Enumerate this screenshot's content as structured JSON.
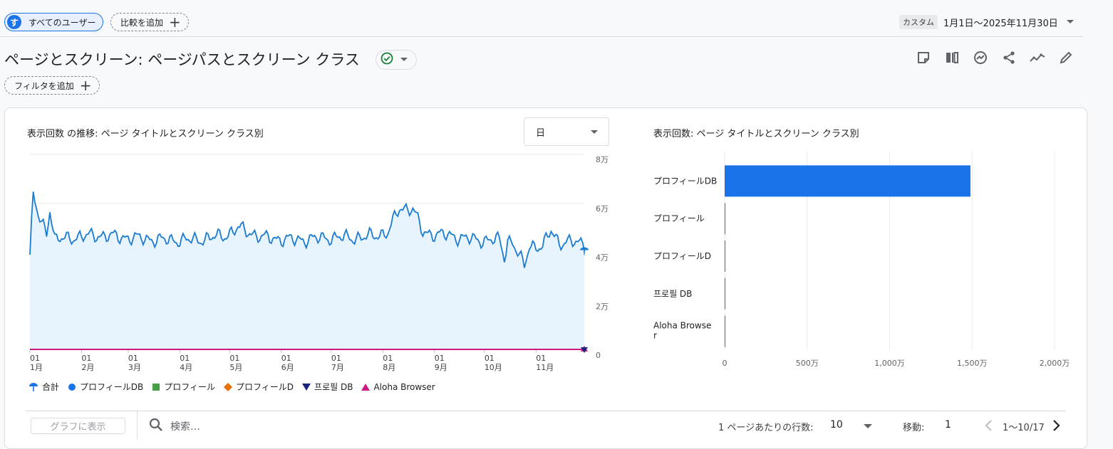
{
  "top_bar": {
    "user_avatar": "す",
    "user_label": "すべてのユーザー",
    "add_compare_label": "比較を追加",
    "date_type": "カスタム",
    "date_range": "1月1日～2025年11月30日"
  },
  "page": {
    "title": "ページとスクリーン: ページパスとスクリーン クラス",
    "add_filter_label": "フィルタを追加"
  },
  "line_chart_card": {
    "title": "表示回数 の推移: ページ タイトルとスクリーン クラス別",
    "granularity": "日"
  },
  "bar_chart_card": {
    "title": "表示回数: ページ タイトルとスクリーン クラス別"
  },
  "legend": [
    {
      "label": "合計",
      "color": "#1a73e8",
      "marker": "total"
    },
    {
      "label": "プロフィールDB",
      "color": "#1a73e8",
      "marker": "circle"
    },
    {
      "label": "プロフィール",
      "color": "#43a047",
      "marker": "square"
    },
    {
      "label": "プロフィールD",
      "color": "#e8710a",
      "marker": "diamond"
    },
    {
      "label": "프로필 DB",
      "color": "#1a237e",
      "marker": "triangle-down"
    },
    {
      "label": "Aloha Browser",
      "color": "#d01884",
      "marker": "triangle-up"
    }
  ],
  "table_controls": {
    "graph_button": "グラフに表示",
    "search_placeholder": "検索…",
    "rows_label": "1 ページあたりの行数:",
    "rows_value": "10",
    "goto_label": "移動:",
    "goto_value": "1",
    "range_label": "1～10/17"
  },
  "colors": {
    "accent": "#1a73e8",
    "area_fill": "#e8f4fd",
    "line": "#1a7bd0",
    "secondary_line": "#d01884"
  },
  "chart_data": [
    {
      "type": "line",
      "title": "表示回数 の推移: ページ タイトルとスクリーン クラス別",
      "x_ticks": [
        {
          "day": "01",
          "month": "1月",
          "index": 0
        },
        {
          "day": "01",
          "month": "2月",
          "index": 31
        },
        {
          "day": "01",
          "month": "3月",
          "index": 59
        },
        {
          "day": "01",
          "month": "4月",
          "index": 90
        },
        {
          "day": "01",
          "month": "5月",
          "index": 120
        },
        {
          "day": "01",
          "month": "6月",
          "index": 151
        },
        {
          "day": "01",
          "month": "7月",
          "index": 181
        },
        {
          "day": "01",
          "month": "8月",
          "index": 212
        },
        {
          "day": "01",
          "month": "9月",
          "index": 243
        },
        {
          "day": "01",
          "month": "10月",
          "index": 273
        },
        {
          "day": "01",
          "month": "11月",
          "index": 304
        }
      ],
      "y_ticks": [
        "0",
        "2万",
        "4万",
        "6万",
        "8万"
      ],
      "ylim": [
        0,
        80000
      ],
      "num_days": 334,
      "series": [
        {
          "name": "合計",
          "anchors": [
            [
              0,
              39000
            ],
            [
              2,
              63000
            ],
            [
              5,
              55000
            ],
            [
              10,
              48000
            ],
            [
              12,
              58000
            ],
            [
              15,
              45000
            ],
            [
              25,
              46000
            ],
            [
              40,
              47000
            ],
            [
              60,
              46000
            ],
            [
              80,
              45000
            ],
            [
              100,
              45000
            ],
            [
              118,
              47000
            ],
            [
              125,
              50000
            ],
            [
              140,
              46000
            ],
            [
              160,
              45000
            ],
            [
              180,
              46000
            ],
            [
              200,
              46000
            ],
            [
              215,
              48000
            ],
            [
              222,
              58000
            ],
            [
              230,
              58000
            ],
            [
              236,
              48000
            ],
            [
              250,
              47000
            ],
            [
              268,
              45000
            ],
            [
              282,
              45000
            ],
            [
              285,
              38000
            ],
            [
              287,
              45000
            ],
            [
              290,
              44000
            ],
            [
              297,
              34000
            ],
            [
              300,
              43000
            ],
            [
              308,
              42000
            ],
            [
              313,
              49000
            ],
            [
              318,
              44000
            ],
            [
              325,
              44000
            ],
            [
              333,
              44000
            ]
          ],
          "amplitude": 2300
        },
        {
          "name": "Aloha Browser",
          "value": 0
        }
      ]
    },
    {
      "type": "bar",
      "orientation": "horizontal",
      "title": "表示回数: ページ タイトルとスクリーン クラス別",
      "categories": [
        "プロフィールDB",
        "プロフィール",
        "プロフィールD",
        "프로필 DB",
        "Aloha Browser"
      ],
      "values": [
        14900000,
        5000,
        4000,
        3000,
        2000
      ],
      "x_ticks": [
        {
          "value": 0,
          "label": "0"
        },
        {
          "value": 5000000,
          "label": "500万"
        },
        {
          "value": 10000000,
          "label": "1,000万"
        },
        {
          "value": 15000000,
          "label": "1,500万"
        },
        {
          "value": 20000000,
          "label": "2,000万"
        }
      ],
      "xlim": [
        0,
        20000000
      ]
    }
  ]
}
